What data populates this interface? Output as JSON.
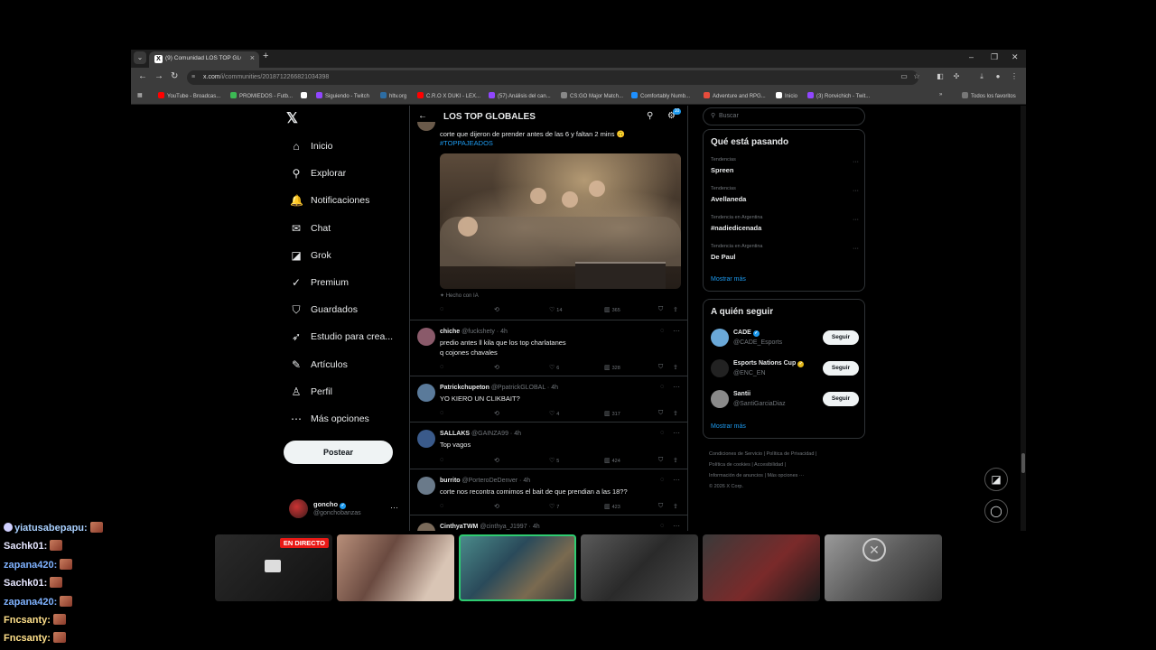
{
  "browser": {
    "tab_title": "(9) Comunidad LOS TOP GLOBAL",
    "url_host": "x.com",
    "url_path": "/i/communities/2018712266821034398",
    "bookmarks": [
      {
        "label": "YouTube - Broadcas...",
        "color": "#ff0000"
      },
      {
        "label": "PROMIEDOS - Futb...",
        "color": "#3cba54"
      },
      {
        "label": "",
        "color": "#ffffff"
      },
      {
        "label": "Siguiendo - Twitch",
        "color": "#9146ff"
      },
      {
        "label": "hltv.org",
        "color": "#2d6da3"
      },
      {
        "label": "C.R.O X DUKI - LEX...",
        "color": "#ff0000"
      },
      {
        "label": "(57) Análisis del can...",
        "color": "#9146ff"
      },
      {
        "label": "CS:GO Major Match...",
        "color": "#888888"
      },
      {
        "label": "Comfortably Numb...",
        "color": "#1e90ff"
      },
      {
        "label": "Adventure and RPG...",
        "color": "#e74c3c"
      },
      {
        "label": "Inicio",
        "color": "#ffffff"
      },
      {
        "label": "(3) Ronvichich - Twit...",
        "color": "#9146ff"
      }
    ],
    "all_bookmarks_label": "Todos los favoritos"
  },
  "nav": {
    "items": [
      {
        "label": "Inicio",
        "icon": "home-icon",
        "glyph": "⌂"
      },
      {
        "label": "Explorar",
        "icon": "search-icon",
        "glyph": "⚲"
      },
      {
        "label": "Notificaciones",
        "icon": "bell-icon",
        "glyph": "🔔"
      },
      {
        "label": "Chat",
        "icon": "mail-icon",
        "glyph": "✉"
      },
      {
        "label": "Grok",
        "icon": "grok-icon",
        "glyph": "◪"
      },
      {
        "label": "Premium",
        "icon": "premium-icon",
        "glyph": "✓"
      },
      {
        "label": "Guardados",
        "icon": "bookmark-icon",
        "glyph": "⛉"
      },
      {
        "label": "Estudio para crea...",
        "icon": "rocket-icon",
        "glyph": "➶"
      },
      {
        "label": "Artículos",
        "icon": "article-icon",
        "glyph": "✎"
      },
      {
        "label": "Perfil",
        "icon": "person-icon",
        "glyph": "♙"
      },
      {
        "label": "Más opciones",
        "icon": "more-icon",
        "glyph": "⋯"
      }
    ],
    "post_button": "Postear",
    "account_name": "goncho",
    "account_handle": "@gonchobanzas"
  },
  "community": {
    "title": "LOS TOP GLOBALES",
    "notif_count": "10"
  },
  "first_post": {
    "text": "corte que dijeron de prender antes de las 6 y faltan 2 mins 🙃",
    "hashtag": "#TOPPAJEADOS",
    "ai_label": "Hecho con IA",
    "likes": "14",
    "views": "365"
  },
  "posts": [
    {
      "name": "chiche",
      "handle": "@fuckshety",
      "time": "4h",
      "lines": [
        "predio antes ll kila que los top charlatanes",
        "q cojones chavales"
      ],
      "likes": "6",
      "views": "328",
      "avatar": "#8a5a6a"
    },
    {
      "name": "Patrickchupeton",
      "handle": "@PpatrickGLOBAL",
      "time": "4h",
      "lines": [
        "YO KIERO UN CLIKBAIT?"
      ],
      "likes": "4",
      "views": "317",
      "avatar": "#5a7a9a"
    },
    {
      "name": "SALLAKS",
      "handle": "@GAINZA99",
      "time": "4h",
      "lines": [
        "Top vagos"
      ],
      "likes": "5",
      "views": "424",
      "avatar": "#3a5a8a"
    },
    {
      "name": "burrito",
      "handle": "@PorteroDeDenver",
      "time": "4h",
      "lines": [
        "corte nos recontra comimos el bait de que prendian a las 18??"
      ],
      "likes": "7",
      "views": "423",
      "avatar": "#6a7a8a"
    },
    {
      "name": "CinthyaTWM",
      "handle": "@cinthya_J1997",
      "time": "4h",
      "lines": [],
      "likes": "",
      "views": "",
      "avatar": "#7a6a5a"
    }
  ],
  "right": {
    "search_placeholder": "Buscar",
    "trends_title": "Qué está pasando",
    "trends": [
      {
        "context": "Tendencias",
        "topic": "Spreen"
      },
      {
        "context": "Tendencias",
        "topic": "Avellaneda"
      },
      {
        "context": "Tendencia en Argentina",
        "topic": "#nadiedicenada"
      },
      {
        "context": "Tendencia en Argentina",
        "topic": "De Paul"
      }
    ],
    "show_more": "Mostrar más",
    "follow_title": "A quién seguir",
    "follow": [
      {
        "name": "CADE",
        "handle": "@CADE_Esports",
        "badge": "blue",
        "avatar": "#6aa8d8"
      },
      {
        "name": "Esports Nations Cup",
        "handle": "@ENC_EN",
        "badge": "gold",
        "avatar": "#222222"
      },
      {
        "name": "Santii",
        "handle": "@SantiGarciaDiaz",
        "badge": "none",
        "avatar": "#8a8a8a"
      }
    ],
    "follow_button": "Seguir",
    "footer": [
      "Condiciones de Servicio",
      "Política de Privacidad",
      "Política de cookies",
      "Accesibilidad",
      "Información de anuncios",
      "Más opciones ···",
      "© 2026 X Corp."
    ]
  },
  "stream": {
    "live_label": "EN DIRECTO",
    "chat": [
      {
        "user": "yiatusabepapu:",
        "color": "#a9d0ff",
        "badge": true
      },
      {
        "user": "Sachk01:",
        "color": "#e6e6ff",
        "badge": false
      },
      {
        "user": "zapana420:",
        "color": "#7fb2ff",
        "badge": false
      },
      {
        "user": "Sachk01:",
        "color": "#e6e6ff",
        "badge": false
      },
      {
        "user": "zapana420:",
        "color": "#7fb2ff",
        "badge": false
      },
      {
        "user": "Fncsanty:",
        "color": "#ffe08a",
        "badge": false
      },
      {
        "user": "Fncsanty:",
        "color": "#ffe08a",
        "badge": false
      }
    ]
  }
}
